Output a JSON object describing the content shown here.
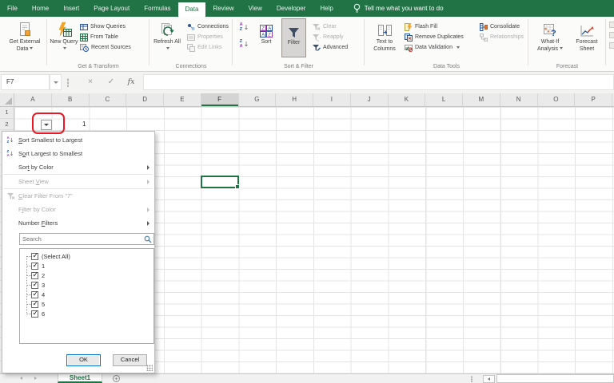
{
  "colors": {
    "excel_green": "#217346",
    "selection_green": "#217346",
    "annotation_red": "#EF1522",
    "focus_blue": "#0078D7"
  },
  "ribbon_tabs": {
    "tabs": [
      "File",
      "Home",
      "Insert",
      "Page Layout",
      "Formulas",
      "Data",
      "Review",
      "View",
      "Developer",
      "Help"
    ],
    "active": "Data",
    "tell_me": "Tell me what you want to do"
  },
  "ribbon": {
    "get_external_data": "Get External Data",
    "new_query": "New Query",
    "show_queries": "Show Queries",
    "from_table": "From Table",
    "recent_sources": "Recent Sources",
    "group_get_transform": "Get & Transform",
    "refresh_all": "Refresh All",
    "connections_item": "Connections",
    "properties_item": "Properties",
    "edit_links": "Edit Links",
    "group_connections": "Connections",
    "sort": "Sort",
    "filter": "Filter",
    "clear": "Clear",
    "reapply": "Reapply",
    "advanced": "Advanced",
    "group_sort_filter": "Sort & Filter",
    "text_to_columns": "Text to Columns",
    "flash_fill": "Flash Fill",
    "remove_duplicates": "Remove Duplicates",
    "data_validation": "Data Validation",
    "consolidate": "Consolidate",
    "relationships": "Relationships",
    "group_data_tools": "Data Tools",
    "what_if_analysis": "What-If Analysis",
    "forecast_sheet": "Forecast Sheet",
    "group_forecast": "Forecast"
  },
  "formula_bar": {
    "name_box": "F7",
    "formula_value": "",
    "fx_label": "fx"
  },
  "grid": {
    "columns": [
      "A",
      "B",
      "C",
      "D",
      "E",
      "F",
      "G",
      "H",
      "I",
      "J",
      "K",
      "L",
      "M",
      "N",
      "O",
      "P"
    ],
    "selected_column": "F",
    "selected_cell_ref": "F7",
    "row_count": 23,
    "b2_value": "1"
  },
  "filter_menu": {
    "items": [
      {
        "label": "&Sort Smallest to Largest",
        "icon": "sort-asc",
        "enabled": true,
        "submenu": false
      },
      {
        "label": "S&ort Largest to Smallest",
        "icon": "sort-desc",
        "enabled": true,
        "submenu": false
      },
      {
        "label": "Sor&t by Color",
        "icon": "",
        "enabled": true,
        "submenu": true
      },
      {
        "sep": true
      },
      {
        "label": "Sheet &View",
        "icon": "",
        "enabled": false,
        "submenu": true
      },
      {
        "sep": true
      },
      {
        "label": "&Clear Filter From \"7\"",
        "icon": "clear-filter",
        "enabled": false,
        "submenu": false
      },
      {
        "label": "F&ilter by Color",
        "icon": "",
        "enabled": false,
        "submenu": true
      },
      {
        "label": "Number &Filters",
        "icon": "",
        "enabled": true,
        "submenu": true
      }
    ],
    "search_placeholder": "Search",
    "list": [
      {
        "label": "(Select All)",
        "checked": true
      },
      {
        "label": "1",
        "checked": true
      },
      {
        "label": "2",
        "checked": true
      },
      {
        "label": "3",
        "checked": true
      },
      {
        "label": "4",
        "checked": true
      },
      {
        "label": "5",
        "checked": true
      },
      {
        "label": "6",
        "checked": true
      }
    ],
    "ok": "OK",
    "cancel": "Cancel"
  },
  "sheet_bar": {
    "active_sheet": "Sheet1"
  }
}
